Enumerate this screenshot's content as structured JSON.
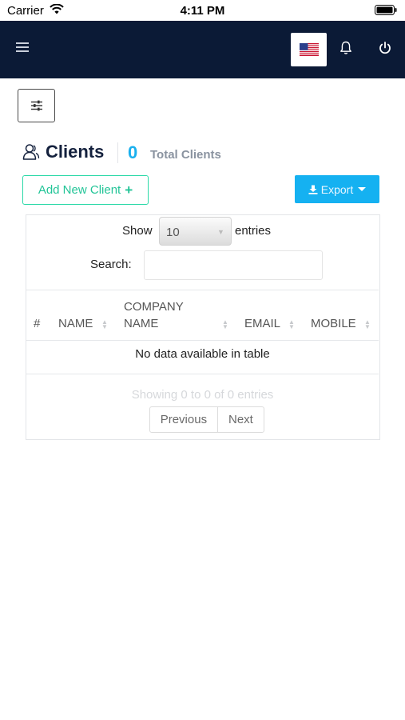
{
  "status_bar": {
    "carrier": "Carrier",
    "time": "4:11 PM"
  },
  "navbar": {
    "background": "#0b1a36"
  },
  "page": {
    "title": "Clients",
    "total_count": "0",
    "total_label": "Total Clients"
  },
  "actions": {
    "add_label": "Add New Client",
    "add_icon": "plus-icon",
    "export_label": "Export",
    "export_icon": "download-icon"
  },
  "table": {
    "show_label": "Show",
    "page_length": "10",
    "entries_label": "entries",
    "search_label": "Search:",
    "search_value": "",
    "columns": [
      "#",
      "NAME",
      "COMPANY",
      "NAME",
      "EMAIL",
      "MOBILE"
    ],
    "empty_text": "No data available in table",
    "info_text": "Showing 0 to 0 of 0 entries",
    "prev_label": "Previous",
    "next_label": "Next"
  },
  "colors": {
    "accent": "#1ab0ee",
    "add_button": "#22c497",
    "export_button": "#15b1f1"
  }
}
